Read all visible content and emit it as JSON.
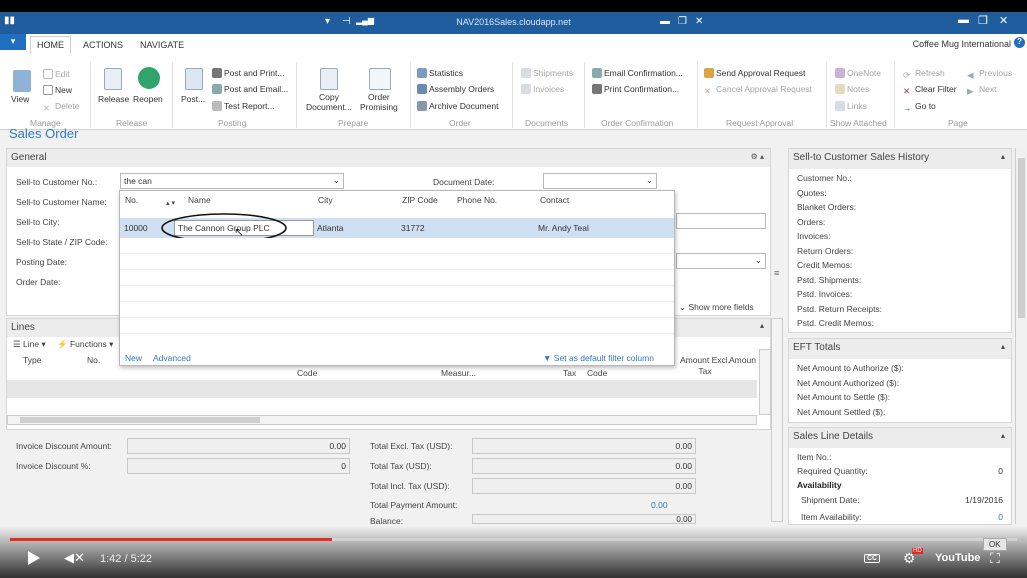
{
  "window": {
    "title": "NAV2016Sales.cloudapp.net"
  },
  "ribbon": {
    "tabs": [
      "HOME",
      "ACTIONS",
      "NAVIGATE"
    ],
    "company": "Coffee Mug International",
    "manage": {
      "view": "View",
      "edit": "Edit",
      "new": "New",
      "delete": "Delete",
      "group": "Manage"
    },
    "release": {
      "release": "Release",
      "reopen": "Reopen",
      "group": "Release"
    },
    "posting": {
      "post": "Post...",
      "post_print": "Post and Print...",
      "post_email": "Post and Email...",
      "test_report": "Test Report...",
      "group": "Posting"
    },
    "prepare": {
      "copy": "Copy",
      "copy2": "Document...",
      "order": "Order",
      "order2": "Promising",
      "group": "Prepare"
    },
    "order": {
      "statistics": "Statistics",
      "assembly": "Assembly Orders",
      "archive": "Archive Document",
      "group": "Order"
    },
    "documents": {
      "shipments": "Shipments",
      "invoices": "Invoices",
      "group": "Documents"
    },
    "order_conf": {
      "email": "Email Confirmation...",
      "print": "Print Confirmation...",
      "group": "Order Confirmation"
    },
    "request": {
      "send": "Send Approval Request",
      "cancel": "Cancel Approval Request",
      "group": "Request Approval"
    },
    "attached": {
      "onenote": "OneNote",
      "notes": "Notes",
      "links": "Links",
      "group": "Show Attached"
    },
    "page": {
      "refresh": "Refresh",
      "clear_filter": "Clear Filter",
      "goto": "Go to",
      "previous": "Previous",
      "next": "Next",
      "group": "Page"
    }
  },
  "page_title": "Sales Order",
  "general": {
    "title": "General",
    "sell_to_no": "Sell-to Customer No.:",
    "sell_to_no_value": "the can",
    "sell_to_name": "Sell-to Customer Name:",
    "sell_to_city": "Sell-to City:",
    "sell_to_state": "Sell-to State / ZIP Code:",
    "posting_date": "Posting Date:",
    "order_date": "Order Date:",
    "document_date": "Document Date:",
    "show_more": "Show more fields"
  },
  "lookup": {
    "columns": [
      "No.",
      "Name",
      "City",
      "ZIP Code",
      "Phone No.",
      "Contact"
    ],
    "row": {
      "no": "10000",
      "name": "The Cannon Group PLC",
      "city": "Atlanta",
      "zip": "31772",
      "phone": "",
      "contact": "Mr. Andy Teal"
    },
    "new": "New",
    "advanced": "Advanced",
    "set_default": "Set as default filter column"
  },
  "lines": {
    "title": "Lines",
    "line": "Line",
    "functions": "Functions",
    "columns": [
      "Type",
      "No.",
      "Code",
      "Measur...",
      "Tax",
      "Code",
      "Amount Excl. Tax",
      "Amoun"
    ]
  },
  "totals": {
    "inv_disc_amount": "Invoice Discount Amount:",
    "inv_disc_amount_value": "0.00",
    "inv_disc_pct": "Invoice Discount %:",
    "inv_disc_pct_value": "0",
    "total_excl": "Total Excl. Tax (USD):",
    "total_excl_value": "0.00",
    "total_tax": "Total Tax (USD):",
    "total_tax_value": "0.00",
    "total_incl": "Total Incl. Tax (USD):",
    "total_incl_value": "0.00",
    "total_payment": "Total Payment Amount:",
    "total_payment_value": "0.00",
    "balance": "Balance:",
    "balance_value": "0.00"
  },
  "factbox": {
    "history_title": "Sell-to Customer Sales History",
    "history": [
      "Customer No.:",
      "Quotes:",
      "Blanket Orders:",
      "Orders:",
      "Invoices:",
      "Return Orders:",
      "Credit Memos:",
      "Pstd. Shipments:",
      "Pstd. Invoices:",
      "Pstd. Return Receipts:",
      "Pstd. Credit Memos:"
    ],
    "eft_title": "EFT Totals",
    "eft": [
      "Net Amount to Authorize ($):",
      "Net Amount Authorized ($):",
      "Net Amount to Settle ($):",
      "Net Amount Settled ($):"
    ],
    "line_title": "Sales Line Details",
    "item_no": "Item No.:",
    "req_qty": "Required Quantity:",
    "req_qty_value": "0",
    "availability": "Availability",
    "ship_date": "Shipment Date:",
    "ship_date_value": "1/19/2016",
    "item_avail": "Item Availability:",
    "item_avail_value": "0"
  },
  "video": {
    "time": "1:42 / 5:22",
    "progress": 0.32,
    "ok": "OK",
    "hd": "HD",
    "youtube": "YouTube",
    "cc": "CC"
  },
  "colors": {
    "accent": "#2f7bbd",
    "titlebar": "#1f5d9e",
    "progress": "#e52d27"
  }
}
